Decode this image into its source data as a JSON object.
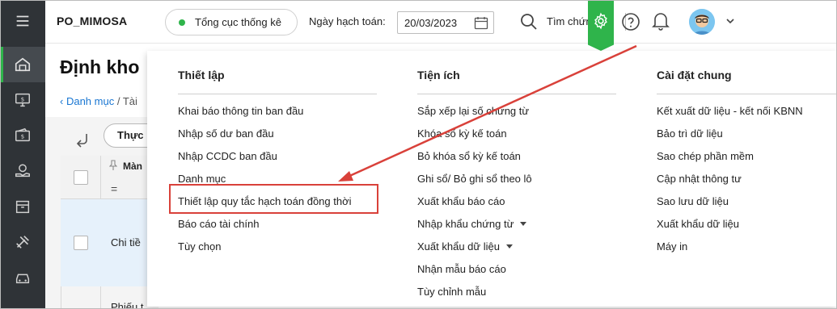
{
  "header": {
    "brand": "PO_MIMOSA",
    "unit": "Tổng cục thống kê",
    "date_label": "Ngày hạch toán:",
    "date_value": "20/03/2023",
    "search_label": "Tìm chứng từ"
  },
  "sidebar": {
    "items": [
      "menu-icon",
      "home-icon",
      "monitor-money-icon",
      "wallet-icon",
      "hand-coin-icon",
      "box-icon",
      "tools-icon",
      "car-icon"
    ]
  },
  "page": {
    "title": "Định kho",
    "breadcrumb_link": "Danh mục",
    "breadcrumb_sep": " / ",
    "breadcrumb_current": "Tài",
    "status_filter": "Thực",
    "column_title": "Màn",
    "filter_operator": "=",
    "row_text": "Chi tiề",
    "row_text_2": "Phiếu t"
  },
  "settings_menu": {
    "columns": [
      {
        "title": "Thiết lập",
        "items": [
          {
            "label": "Khai báo thông tin ban đầu"
          },
          {
            "label": "Nhập số dư ban đầu"
          },
          {
            "label": "Nhập CCDC ban đầu"
          },
          {
            "label": "Danh mục"
          },
          {
            "label": "Thiết lập quy tắc hạch toán đồng thời",
            "highlighted": true
          },
          {
            "label": "Báo cáo tài chính"
          },
          {
            "label": "Tùy chọn"
          }
        ]
      },
      {
        "title": "Tiện ích",
        "items": [
          {
            "label": "Sắp xếp lại số chứng từ"
          },
          {
            "label": "Khóa sổ kỳ kế toán"
          },
          {
            "label": "Bỏ khóa sổ kỳ kế toán"
          },
          {
            "label": "Ghi sổ/ Bỏ ghi sổ theo lô"
          },
          {
            "label": "Xuất khẩu báo cáo"
          },
          {
            "label": "Nhập khẩu chứng từ",
            "submenu": true
          },
          {
            "label": "Xuất khẩu dữ liệu",
            "submenu": true
          },
          {
            "label": "Nhận mẫu báo cáo"
          },
          {
            "label": "Tùy chỉnh mẫu"
          }
        ]
      },
      {
        "title": "Cài đặt chung",
        "items": [
          {
            "label": "Kết xuất dữ liệu - kết nối KBNN"
          },
          {
            "label": "Bảo trì dữ liệu"
          },
          {
            "label": "Sao chép phần mềm"
          },
          {
            "label": "Cập nhật thông tư"
          },
          {
            "label": "Sao lưu dữ liệu"
          },
          {
            "label": "Xuất khẩu dữ liệu"
          },
          {
            "label": "Máy in"
          }
        ]
      }
    ]
  },
  "colors": {
    "sidebar_bg": "#2f3337",
    "accent_green": "#2fb44b",
    "annotation_red": "#d9413a",
    "link_blue": "#1976d2"
  }
}
